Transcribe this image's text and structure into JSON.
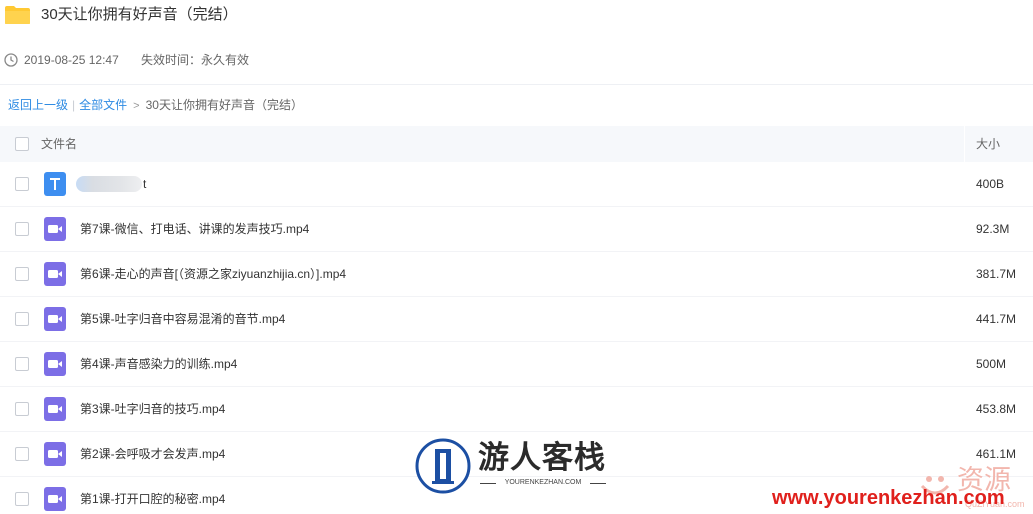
{
  "header": {
    "title": "30天让你拥有好声音（完结）",
    "date": "2019-08-25 12:47",
    "expire": "失效时间：永久有效"
  },
  "breadcrumb": {
    "back": "返回上一级",
    "all": "全部文件",
    "arrow": ">",
    "current": "30天让你拥有好声音（完结）"
  },
  "table": {
    "col_name": "文件名",
    "col_size": "大小",
    "rows": [
      {
        "name": "t",
        "size": "400B",
        "icon": "text-file-icon",
        "blurred": true
      },
      {
        "name": "第7课-微信、打电话、讲课的发声技巧.mp4",
        "size": "92.3M",
        "icon": "video-file-icon"
      },
      {
        "name": "第6课-走心的声音[（资源之家ziyuanzhijia.cn）].mp4",
        "size": "381.7M",
        "icon": "video-file-icon"
      },
      {
        "name": "第5课-吐字归音中容易混淆的音节.mp4",
        "size": "441.7M",
        "icon": "video-file-icon"
      },
      {
        "name": "第4课-声音感染力的训练.mp4",
        "size": "500M",
        "icon": "video-file-icon"
      },
      {
        "name": "第3课-吐字归音的技巧.mp4",
        "size": "453.8M",
        "icon": "video-file-icon"
      },
      {
        "name": "第2课-会呼吸才会发声.mp4",
        "size": "461.1M",
        "icon": "video-file-icon"
      },
      {
        "name": "第1课-打开口腔的秘密.mp4",
        "size": "",
        "icon": "video-file-icon"
      }
    ]
  },
  "watermark": {
    "brand": "游人客栈",
    "sub": "YOURENKEZHAN.COM",
    "url": "www.yourenkezhan.com",
    "cn": "资源",
    "small": "QuZiYuan.com"
  },
  "colors": {
    "accent": "#2e8be3",
    "folder": "#ffc933",
    "video_icon": "#7c6ee6",
    "text_icon": "#3d8ef0",
    "watermark_red": "#e0201c"
  }
}
